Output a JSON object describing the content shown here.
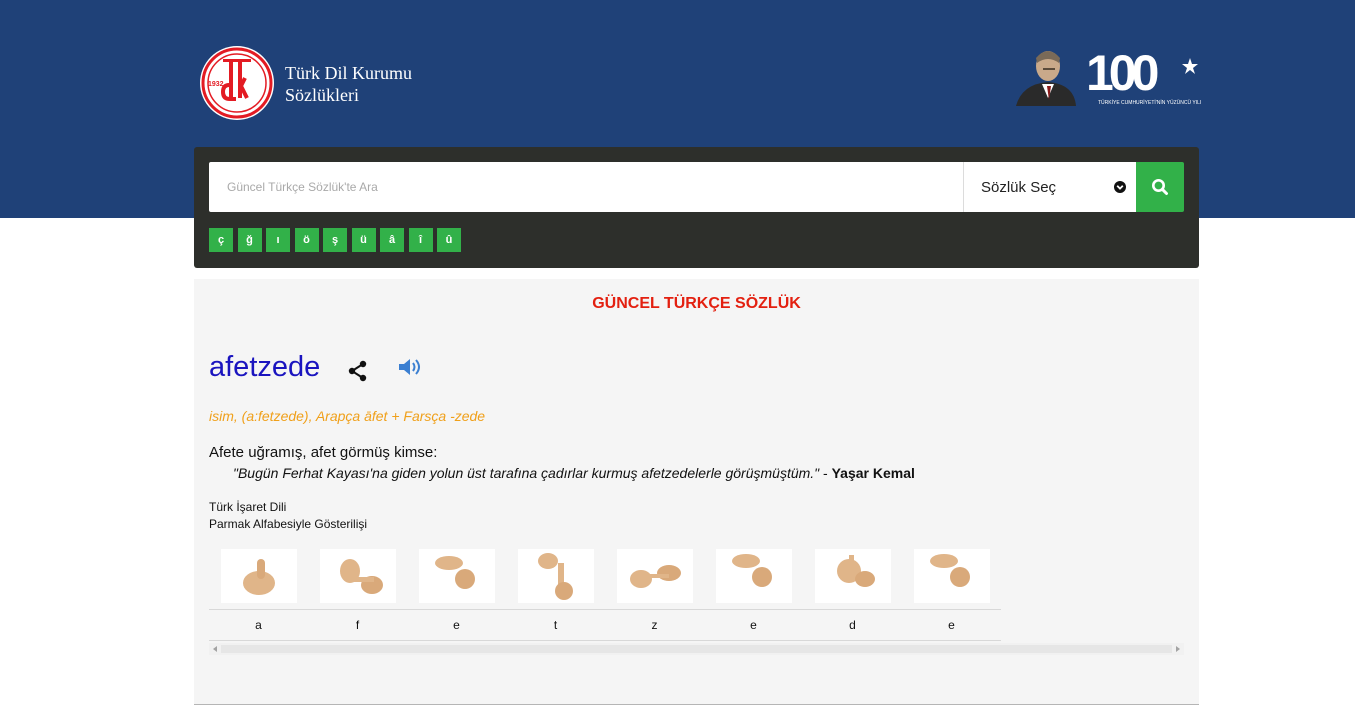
{
  "header": {
    "brand_line1": "Türk Dil Kurumu",
    "brand_line2": "Sözlükleri",
    "logo_year": "1932",
    "logo_letters": "tdk",
    "badge_number": "100",
    "badge_caption": "TÜRKİYE CUMHURİYETİ'NİN YÜZÜNCÜ YILI"
  },
  "search": {
    "placeholder": "Güncel Türkçe Sözlük'te Ara",
    "dictionary_select": "Sözlük Seç",
    "search_icon": "search-icon",
    "special_chars": [
      "ç",
      "ğ",
      "ı",
      "ö",
      "ş",
      "ü",
      "â",
      "î",
      "û"
    ]
  },
  "result": {
    "dictionary_title": "GÜNCEL TÜRKÇE SÖZLÜK",
    "word": "afetzede",
    "meta": "isim, (a:fetzede), Arapça āfet + Farsça -zede",
    "meaning": "Afete uğramış, afet görmüş kimse:",
    "quote_text": "\"Bugün Ferhat Kayası'na giden yolun üst tarafına çadırlar kurmuş afetzedelerle görüşmüştüm.\"",
    "quote_sep": " - ",
    "quote_author": "Yaşar Kemal",
    "sign_language_label": "Türk İşaret Dili",
    "fingerspelling_label": "Parmak Alfabesiyle Gösterilişi",
    "letters": [
      "a",
      "f",
      "e",
      "t",
      "z",
      "e",
      "d",
      "e"
    ]
  },
  "colors": {
    "header_bg": "#1f4178",
    "panel_bg": "#2d2f2b",
    "accent_green": "#32b149",
    "dict_title_red": "#e32010",
    "word_blue": "#1a14bf",
    "meta_orange": "#f0a01a"
  }
}
